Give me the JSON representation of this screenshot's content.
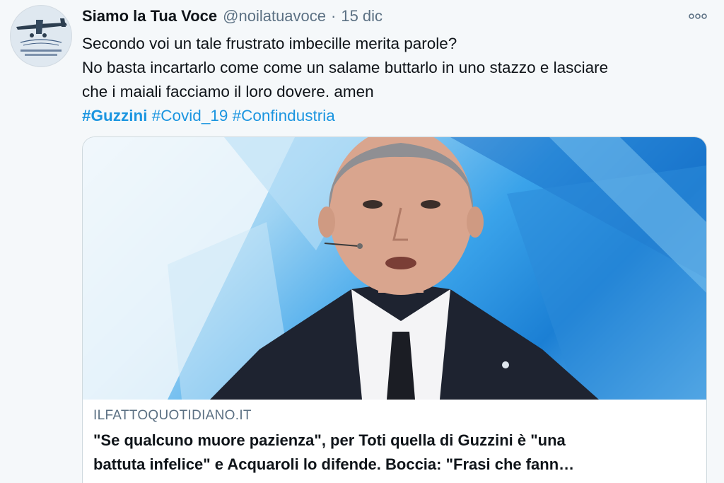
{
  "tweet": {
    "avatar_icon": "plane-logo-avatar",
    "display_name": "Siamo la Tua Voce",
    "handle": "@noilatuavoce",
    "separator": "·",
    "date": "15 dic",
    "more_icon": "more-options-icon",
    "text_line1": "Secondo voi un tale frustrato imbecille merita parole?",
    "text_line2": "No basta incartarlo come come un salame buttarlo in uno stazzo e lasciare",
    "text_line3": "che i maiali facciamo il loro dovere. amen",
    "hashtags": [
      "#Guzzini",
      "#Covid_19",
      "#Confindustria"
    ],
    "link_color": "#1b95e0"
  },
  "card": {
    "domain": "ILFATTOQUOTIDIANO.IT",
    "title_line1": "\"Se qualcuno muore pazienza\", per Toti quella di Guzzini è \"una",
    "title_line2": "battuta infelice\" e Acquaroli lo difende. Boccia: \"Frasi che fann…"
  }
}
